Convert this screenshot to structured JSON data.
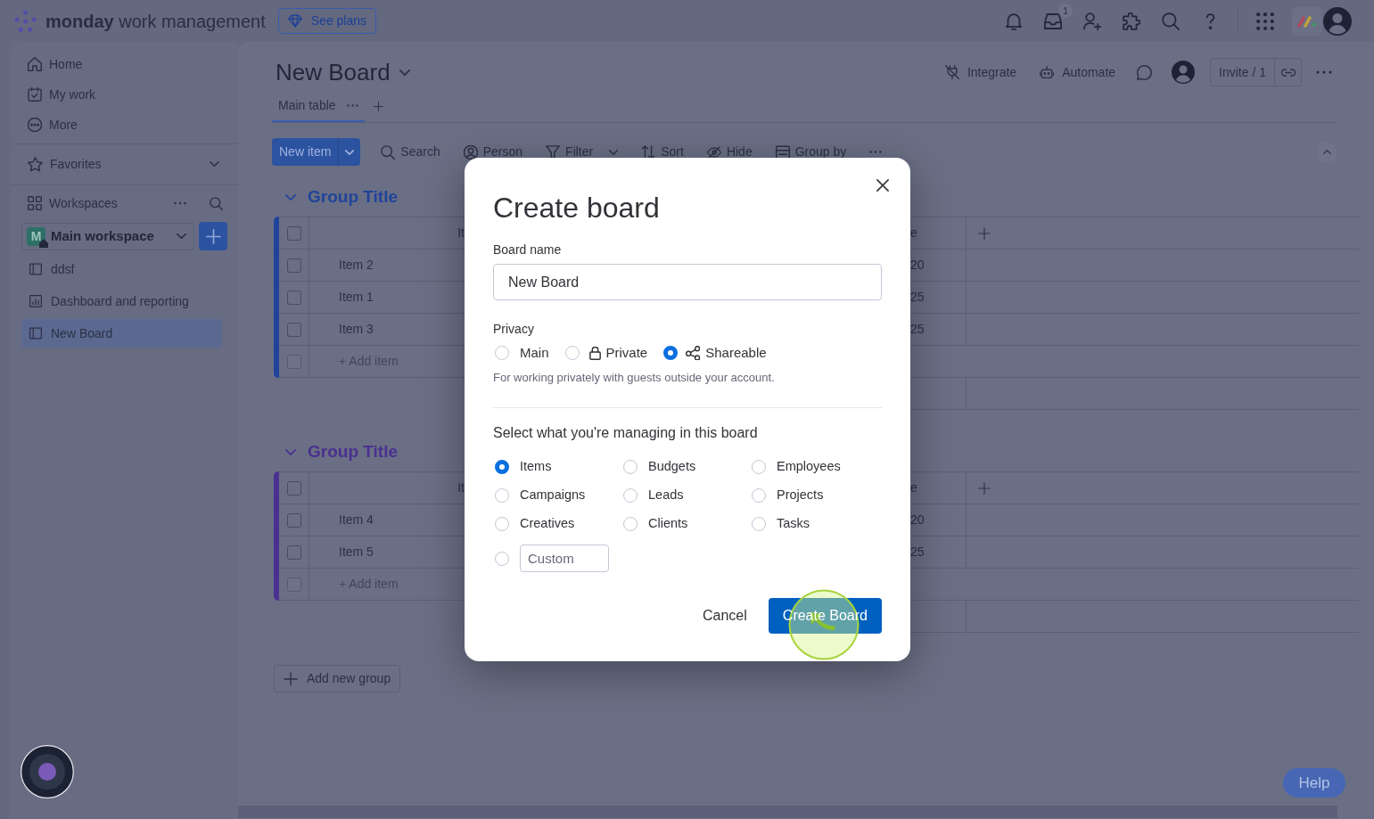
{
  "top_bar": {
    "logo": "**monday** work management",
    "plans_button": "See plans",
    "inbox_badge": "1"
  },
  "sidebar": {
    "nav": [
      {
        "label": "Home",
        "kind": "home"
      },
      {
        "label": "My work",
        "kind": "calendar"
      },
      {
        "label": "More",
        "kind": "more"
      }
    ],
    "favorites": "Favorites",
    "workspaces_label": "Workspaces",
    "workspace": {
      "initial": "M",
      "name": "Main workspace"
    },
    "items": [
      {
        "label": "ddsf",
        "kind": "board",
        "selected": false
      },
      {
        "label": "Dashboard and reporting",
        "kind": "dashboard",
        "selected": false
      },
      {
        "label": "New Board",
        "kind": "board",
        "selected": true
      }
    ]
  },
  "board": {
    "title": "New Board",
    "actions": [
      {
        "label": "Integrate",
        "kind": "integrate"
      },
      {
        "label": "Automate",
        "kind": "automate"
      }
    ],
    "invite_button": "Invite / 1",
    "tabs": [
      {
        "label": "Main table",
        "selected": true
      }
    ],
    "toolbar": {
      "new_item": "New item",
      "tools": [
        {
          "label": "Search",
          "kind": "search"
        },
        {
          "label": "Person",
          "kind": "person"
        },
        {
          "label": "Filter",
          "kind": "filter"
        },
        {
          "label": "Sort",
          "kind": "sort"
        },
        {
          "label": "Hide",
          "kind": "hide"
        },
        {
          "label": "Group by",
          "kind": "group"
        }
      ]
    },
    "groups": [
      {
        "title": "Group Title",
        "color": "#21449a",
        "header_checked": false,
        "columns": {
          "column_1": "It",
          "column_2": "e"
        },
        "rows": [
          {
            "column_1": "Item 2",
            "column_2": "20",
            "checked": false
          },
          {
            "column_1": "Item 1",
            "column_2": "25",
            "checked": false
          },
          {
            "column_1": "Item 3",
            "column_2": "25",
            "checked": false
          }
        ],
        "add_item": "+ Add item",
        "add_row_checkbox": {
          "checked": false,
          "disabled": true
        }
      },
      {
        "title": "Group Title",
        "color": "#4a3090",
        "header_checked": false,
        "columns": {
          "column_1": "It",
          "column_2": "e"
        },
        "rows": [
          {
            "column_1": "Item 4",
            "column_2": "20",
            "checked": false
          },
          {
            "column_1": "Item 5",
            "column_2": "25",
            "checked": false
          }
        ],
        "add_item": "+ Add item",
        "add_row_checkbox": {
          "checked": false,
          "disabled": true
        }
      }
    ],
    "add_group_button": "Add new group"
  },
  "dialog": {
    "title": "Create board",
    "name_label": "Board name",
    "name_value": "New Board",
    "privacy_label": "Privacy",
    "privacy_options": [
      {
        "label": "Main",
        "kind": "plain",
        "selected": false
      },
      {
        "label": "Private",
        "kind": "locked",
        "selected": false
      },
      {
        "label": "Shareable",
        "kind": "shared",
        "selected": true
      }
    ],
    "privacy_hint": "For working privately with guests outside your account.",
    "managing_label": "Select what you're managing in this board",
    "managing_options": [
      {
        "label": "Items",
        "selected": true
      },
      {
        "label": "Budgets",
        "selected": false
      },
      {
        "label": "Employees",
        "selected": false
      },
      {
        "label": "Campaigns",
        "selected": false
      },
      {
        "label": "Leads",
        "selected": false
      },
      {
        "label": "Projects",
        "selected": false
      },
      {
        "label": "Creatives",
        "selected": false
      },
      {
        "label": "Clients",
        "selected": false
      },
      {
        "label": "Tasks",
        "selected": false
      }
    ],
    "custom_option": {
      "placeholder": "Custom",
      "selected": false
    },
    "buttons": [
      {
        "label": "Cancel",
        "kind": "secondary"
      },
      {
        "label": "Create Board",
        "kind": "primary"
      }
    ]
  },
  "help_button": "Help"
}
